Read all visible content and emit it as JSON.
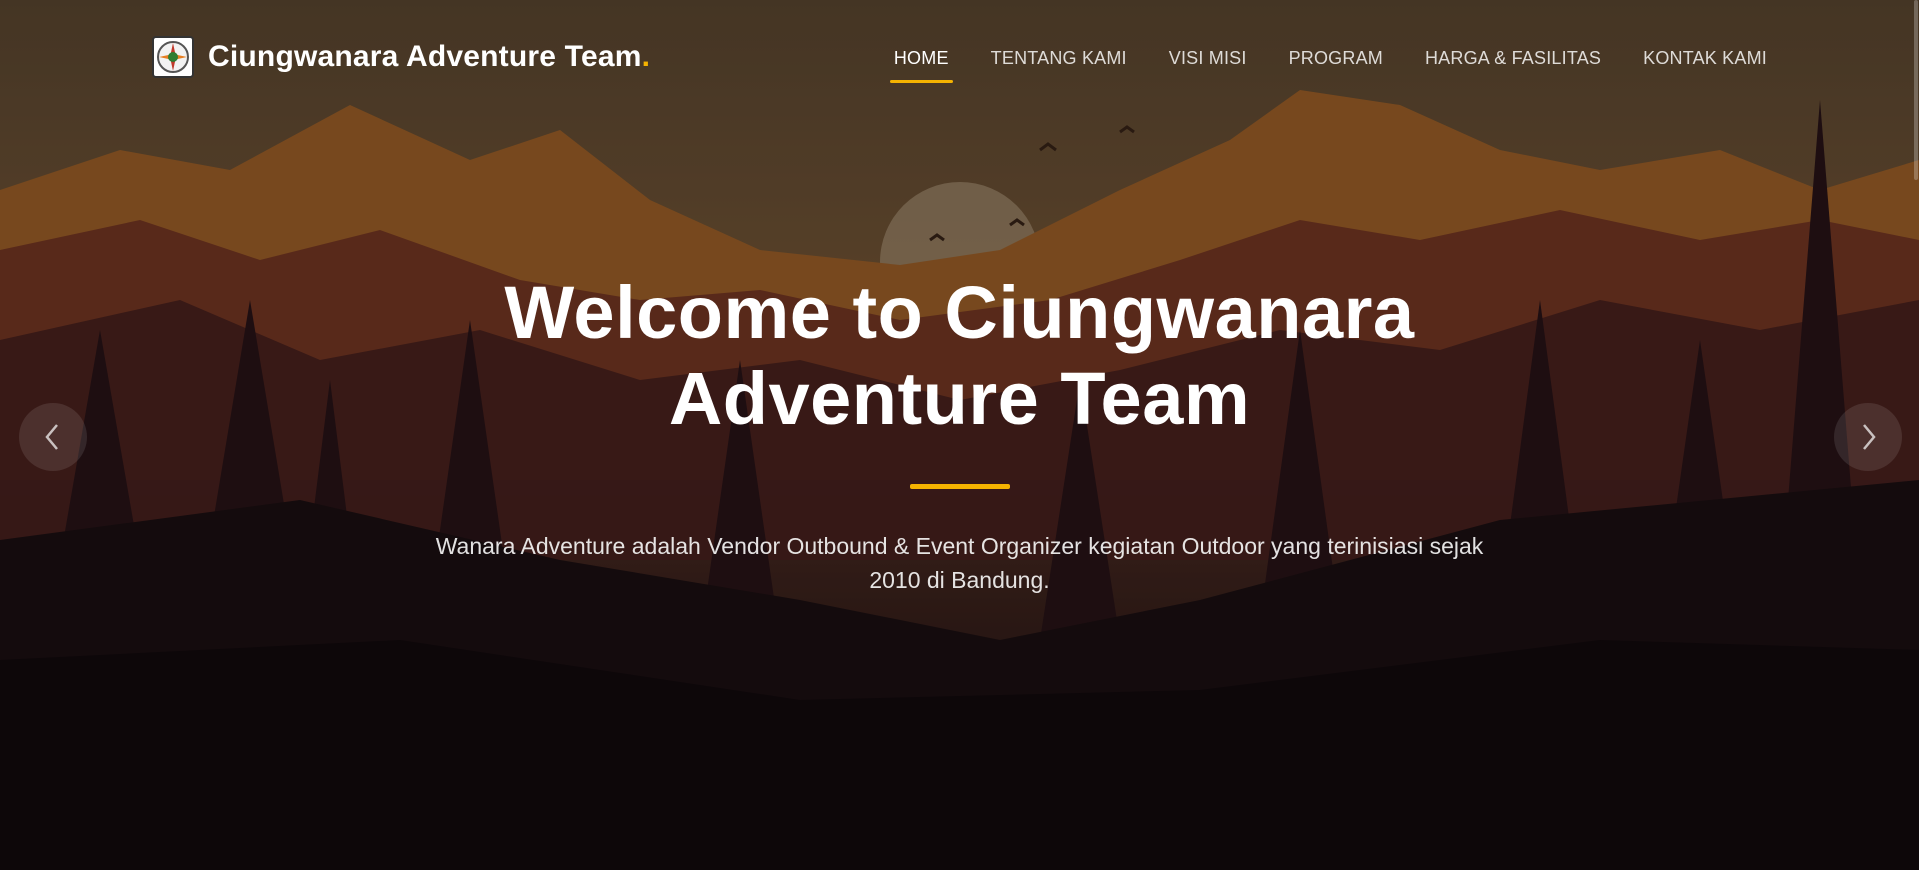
{
  "brand": {
    "name": "Ciungwanara Adventure Team",
    "dot": ".",
    "logo_icon": "compass-emblem-icon"
  },
  "nav": {
    "items": [
      {
        "label": "HOME",
        "active": true
      },
      {
        "label": "TENTANG KAMI"
      },
      {
        "label": "VISI MISI"
      },
      {
        "label": "PROGRAM"
      },
      {
        "label": "HARGA & FASILITAS"
      },
      {
        "label": "KONTAK KAMI"
      }
    ]
  },
  "hero": {
    "title": "Welcome to Ciungwanara Adventure Team",
    "subtitle": "Wanara Adventure adalah Vendor Outbound & Event Organizer kegiatan Outdoor yang terinisiasi sejak 2010 di Bandung."
  },
  "carousel": {
    "prev_icon": "chevron-left-icon",
    "next_icon": "chevron-right-icon"
  },
  "colors": {
    "accent": "#f5b301",
    "sky": "#6e5336",
    "mountain_far": "#a8662a",
    "forest_dark": "#1a0f12"
  }
}
